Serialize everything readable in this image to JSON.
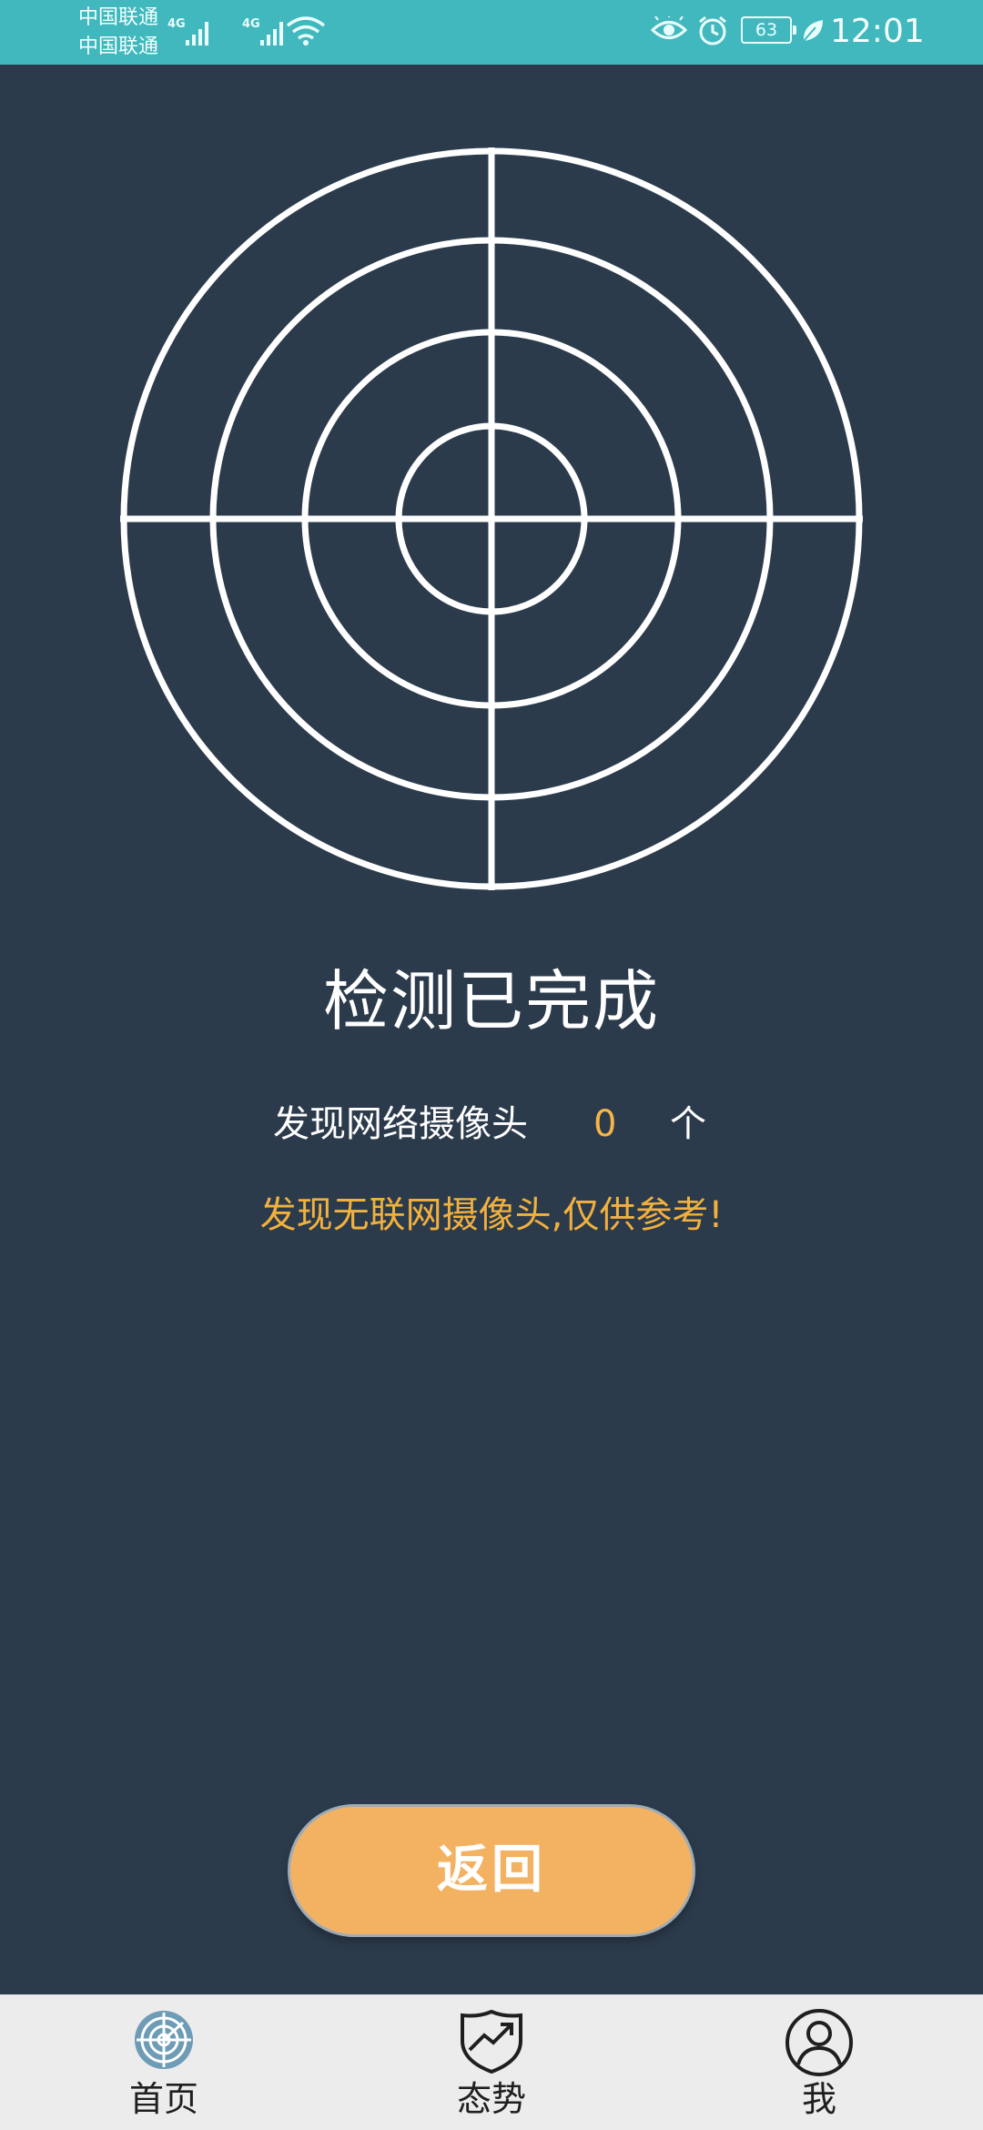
{
  "status_bar": {
    "carrier_1": "中国联通",
    "carrier_2": "中国联通",
    "network_1": "4G",
    "network_2": "4G",
    "battery": "63",
    "time": "12:01",
    "icons": [
      "signal-icon",
      "wifi-icon",
      "eye-comfort-icon",
      "alarm-icon",
      "battery-icon",
      "leaf-icon"
    ]
  },
  "main": {
    "title": "检测已完成",
    "found_label": "发现网络摄像头",
    "found_count": "0",
    "found_unit": "个",
    "notice": "发现无联网摄像头,仅供参考!"
  },
  "actions": {
    "return_label": "返回"
  },
  "tabs": [
    {
      "label": "首页",
      "icon": "radar-icon",
      "active": true
    },
    {
      "label": "态势",
      "icon": "shield-trend-icon",
      "active": false
    },
    {
      "label": "我",
      "icon": "user-icon",
      "active": false
    }
  ],
  "colors": {
    "background": "#2c3b4c",
    "status_bar": "#41b8bd",
    "accent": "#f3b262",
    "highlight_text": "#f2b13e",
    "tabbar": "#ececec"
  }
}
